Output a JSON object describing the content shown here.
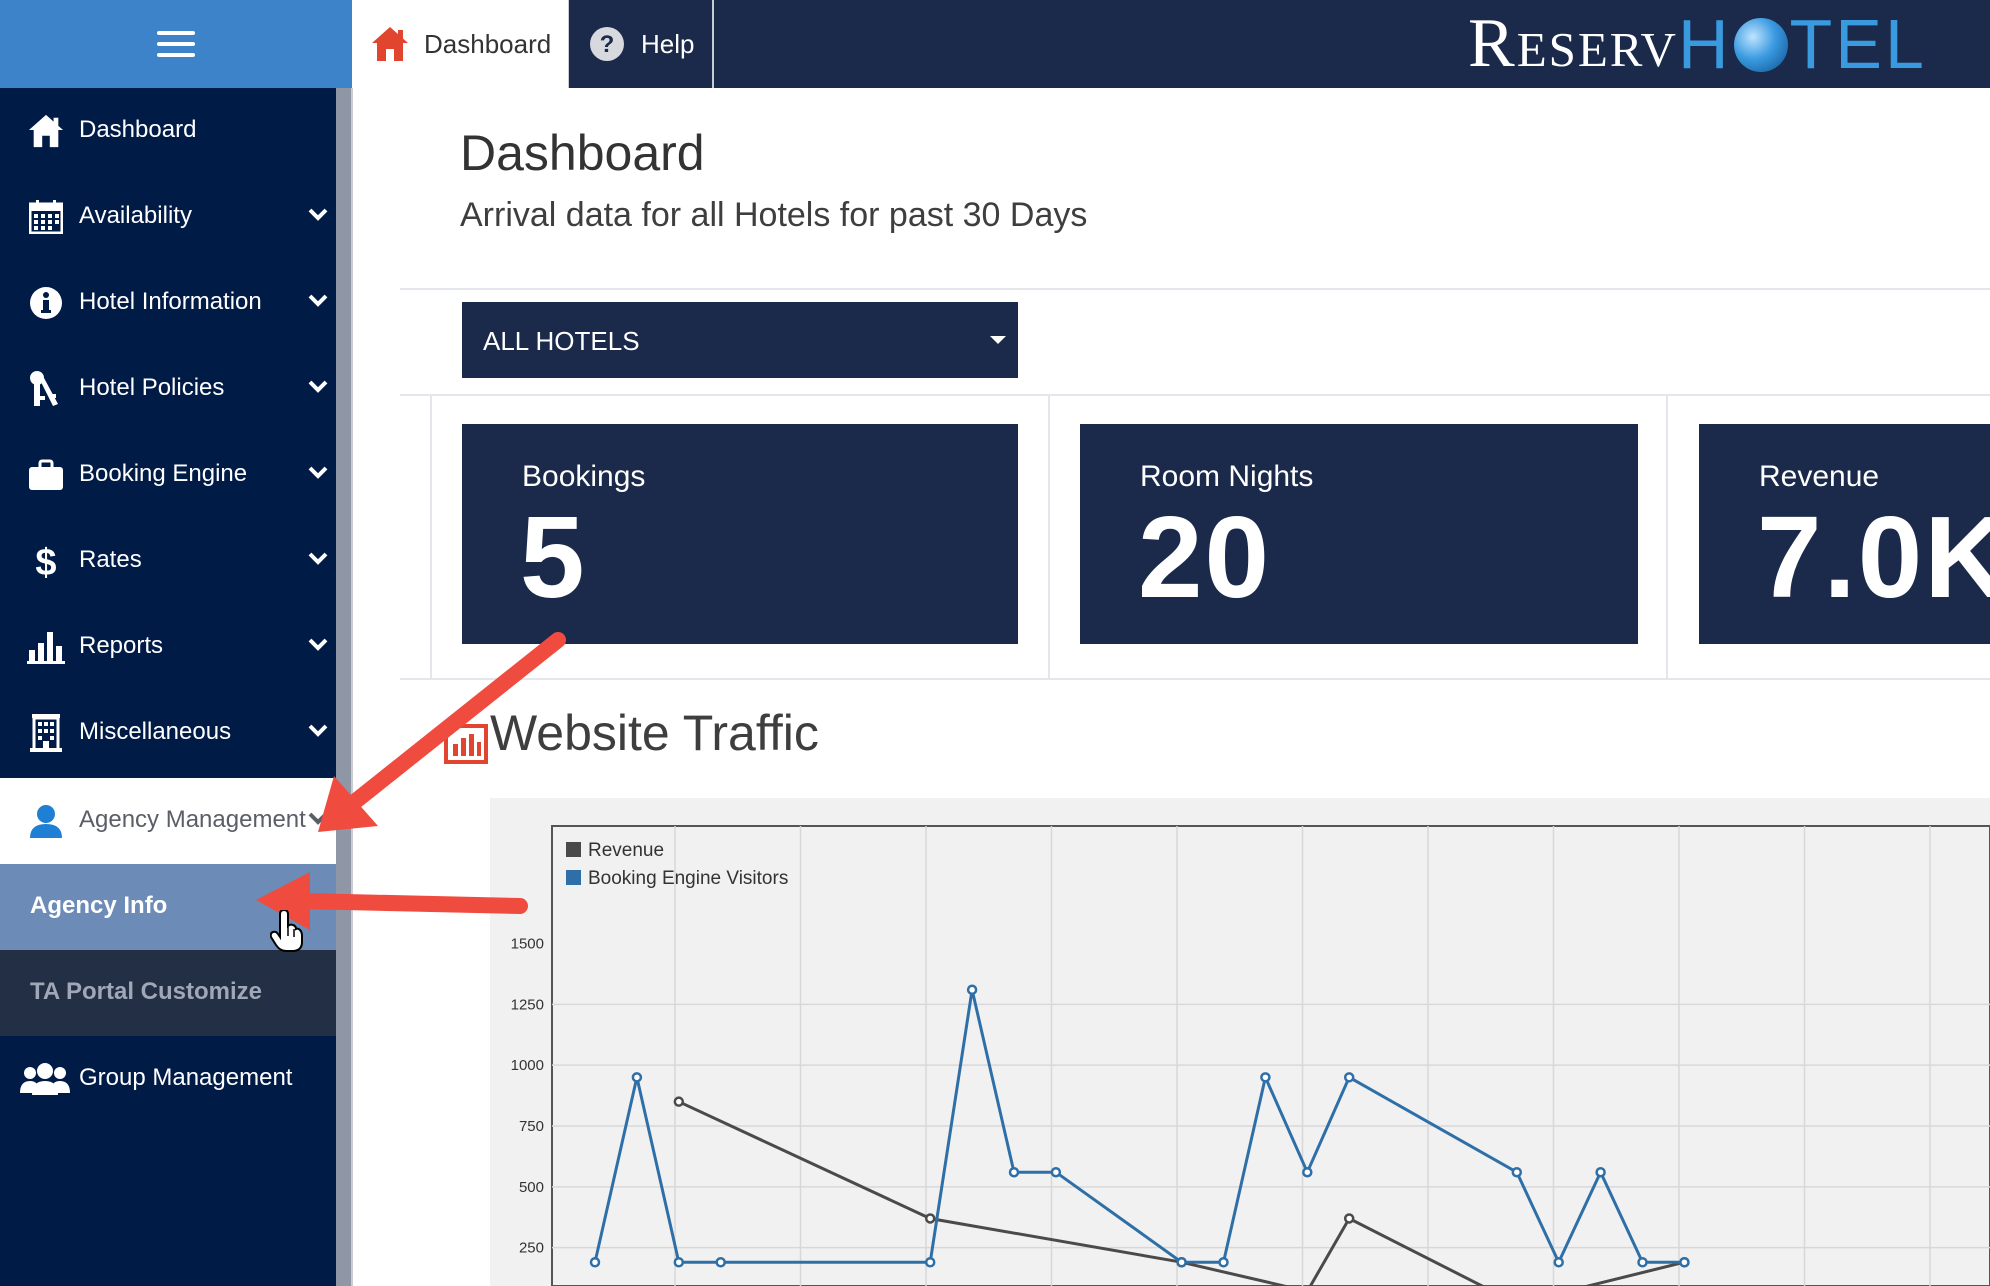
{
  "topbar": {
    "tabs": [
      {
        "label": "Dashboard",
        "icon": "home-icon"
      },
      {
        "label": "Help",
        "icon": "help-icon"
      }
    ],
    "logo": {
      "part1": "Reserv",
      "part2a": "H",
      "part2b": "TEL"
    }
  },
  "sidebar": {
    "items": [
      {
        "label": "Dashboard",
        "icon": "home-icon"
      },
      {
        "label": "Availability",
        "icon": "calendar-icon"
      },
      {
        "label": "Hotel Information",
        "icon": "info-icon"
      },
      {
        "label": "Hotel Policies",
        "icon": "keys-icon"
      },
      {
        "label": "Booking Engine",
        "icon": "briefcase-icon"
      },
      {
        "label": "Rates",
        "icon": "dollar-icon"
      },
      {
        "label": "Reports",
        "icon": "bar-chart-icon"
      },
      {
        "label": "Miscellaneous",
        "icon": "building-icon"
      },
      {
        "label": "Agency Management",
        "icon": "user-icon"
      },
      {
        "label": "Group Management",
        "icon": "users-icon"
      }
    ],
    "subitems": [
      {
        "label": "Agency Info"
      },
      {
        "label": "TA Portal Customize"
      }
    ]
  },
  "main": {
    "title": "Dashboard",
    "subtitle": "Arrival data for all Hotels for past 30 Days",
    "hotel_select": {
      "value": "ALL HOTELS"
    },
    "stats": [
      {
        "label": "Bookings",
        "value": "5"
      },
      {
        "label": "Room Nights",
        "value": "20"
      },
      {
        "label": "Revenue",
        "value": "7.0K"
      }
    ],
    "traffic_title": "Website Traffic"
  },
  "colors": {
    "navy": "#1b2a4a",
    "sidebar": "#011b47",
    "accent_blue": "#3d83c9",
    "series_revenue": "#4a4a4a",
    "series_visitors": "#2f6fa8",
    "arrow": "#f04b3f"
  },
  "chart_data": {
    "type": "line",
    "yticks": [
      250,
      500,
      750,
      1000,
      1250,
      1500
    ],
    "ylim": [
      0,
      1500
    ],
    "legend_position": "top-left",
    "grid": true,
    "series": [
      {
        "name": "Revenue",
        "points": [
          [
            3,
            850
          ],
          [
            9,
            370
          ],
          [
            15,
            190
          ],
          [
            18,
            70
          ],
          [
            19,
            370
          ],
          [
            23,
            20
          ],
          [
            27,
            190
          ]
        ]
      },
      {
        "name": "Booking Engine Visitors",
        "points": [
          [
            1,
            190
          ],
          [
            2,
            950
          ],
          [
            3,
            190
          ],
          [
            4,
            190
          ],
          [
            9,
            190
          ],
          [
            10,
            1310
          ],
          [
            11,
            560
          ],
          [
            12,
            560
          ],
          [
            15,
            190
          ],
          [
            16,
            190
          ],
          [
            17,
            950
          ],
          [
            18,
            560
          ],
          [
            19,
            950
          ],
          [
            23,
            560
          ],
          [
            24,
            190
          ],
          [
            25,
            560
          ],
          [
            26,
            190
          ],
          [
            27,
            190
          ]
        ]
      }
    ]
  }
}
